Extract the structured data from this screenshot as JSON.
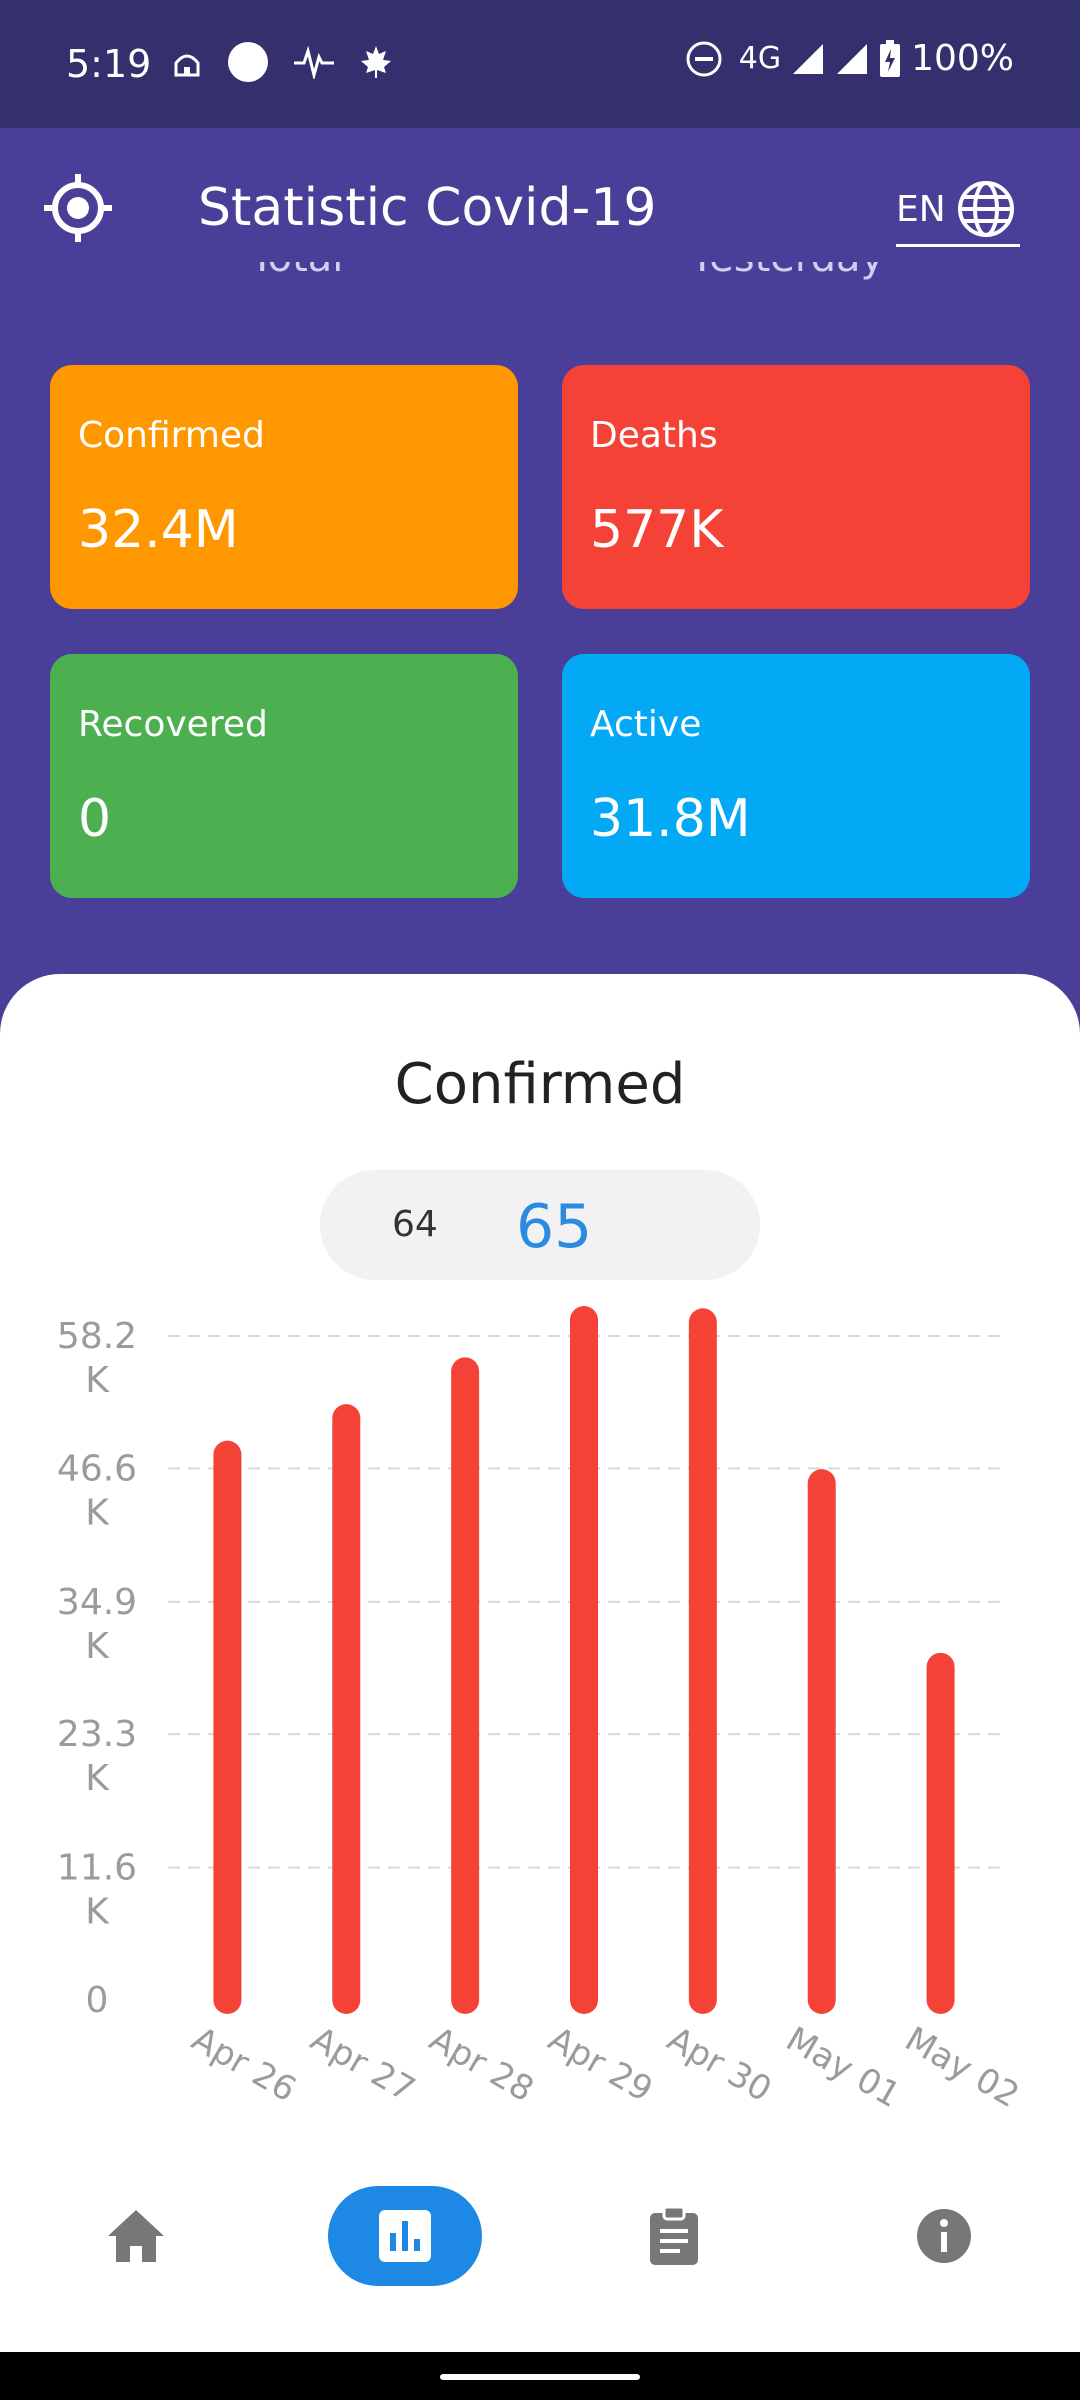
{
  "status_bar": {
    "time": "5:19",
    "network": "4G",
    "battery": "100%",
    "left_icons": [
      "mosque-icon",
      "circle-icon",
      "pulse-icon",
      "maple-leaf-icon"
    ],
    "right_icons": [
      "do-not-disturb-icon",
      "signal-icon",
      "signal-icon",
      "battery-charging-icon"
    ]
  },
  "app_bar": {
    "title": "Statistic Covid-19",
    "language": "EN",
    "left_icon": "gps-target-icon",
    "right_icon": "globe-icon"
  },
  "tabs": [
    "Total",
    "Yesterday"
  ],
  "cards": [
    {
      "label": "Confirmed",
      "value": "32.4M",
      "color": "#fe9700"
    },
    {
      "label": "Deaths",
      "value": "577K",
      "color": "#f44336"
    },
    {
      "label": "Recovered",
      "value": "0",
      "color": "#4caf50"
    },
    {
      "label": "Active",
      "value": "31.8M",
      "color": "#03a9f4"
    }
  ],
  "chart_section": {
    "title": "Confirmed",
    "page_prev": "64",
    "page_current": "65"
  },
  "chart_data": {
    "type": "bar",
    "title": "Confirmed",
    "categories": [
      "Apr 26",
      "Apr 27",
      "Apr 28",
      "Apr 29",
      "Apr 30",
      "May 01",
      "May 02"
    ],
    "values": [
      47800,
      51000,
      55100,
      59600,
      59400,
      45300,
      29200
    ],
    "ylim": [
      0,
      58200
    ],
    "yticks": [
      0,
      11600,
      23300,
      34900,
      46600,
      58200
    ],
    "ytick_labels": [
      [
        "0"
      ],
      [
        "11.6",
        "K"
      ],
      [
        "23.3",
        "K"
      ],
      [
        "34.9",
        "K"
      ],
      [
        "46.6",
        "K"
      ],
      [
        "58.2",
        "K"
      ]
    ],
    "bar_color": "#f44336",
    "grid": true
  },
  "bottom_nav": [
    {
      "name": "home-icon",
      "active": false
    },
    {
      "name": "bar-chart-icon",
      "active": true
    },
    {
      "name": "clipboard-icon",
      "active": false
    },
    {
      "name": "info-icon",
      "active": false
    }
  ],
  "colors": {
    "background": "#493f99",
    "status_bar": "#34306e",
    "accent": "#1e88e5"
  }
}
